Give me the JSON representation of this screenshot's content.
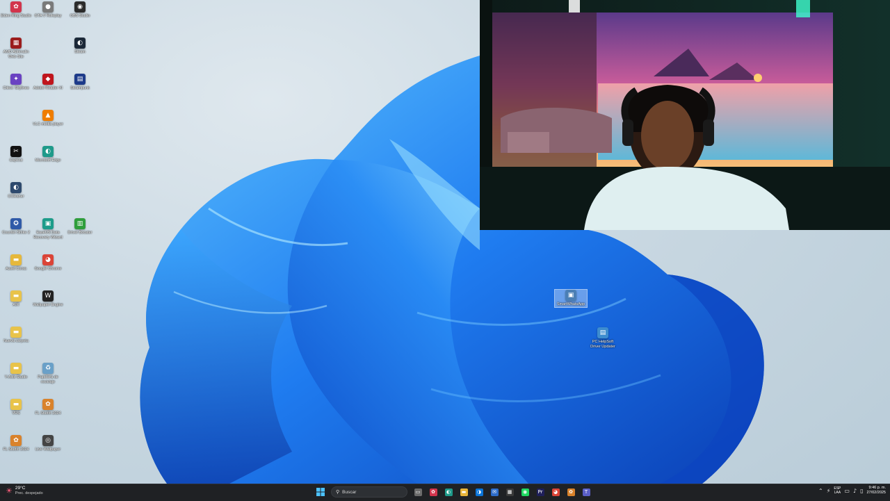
{
  "desktop_icons_left": [
    {
      "label": "Elden Ring Studio",
      "color": "#d2354d",
      "glyph": "✿"
    },
    {
      "label": "GTA V Roleplay",
      "color": "#7a7a7a",
      "glyph": "●"
    },
    {
      "label": "OBS Studio",
      "color": "#2b2b2b",
      "glyph": "◉"
    },
    {
      "label": "AMD Adrenalin Web Site",
      "color": "#9b1c1c",
      "glyph": "▦"
    },
    {
      "label": "Steam",
      "color": "#1b2838",
      "glyph": "◐"
    },
    {
      "label": "Cities: Skylines",
      "color": "#6a42c2",
      "glyph": "✦"
    },
    {
      "label": "Adobe Reader XI",
      "color": "#c0151d",
      "glyph": "◆"
    },
    {
      "label": "Steampunk",
      "color": "#1d3b8a",
      "glyph": "▤"
    },
    {
      "label": "VLC media player",
      "color": "#ef7d00",
      "glyph": "▲"
    },
    {
      "label": "CapCut",
      "color": "#111111",
      "glyph": "✂"
    },
    {
      "label": "Microsoft Edge",
      "color": "#1e9a8a",
      "glyph": "◐"
    },
    {
      "label": "CCleaner",
      "color": "#2e4a6e",
      "glyph": "◐"
    },
    {
      "label": "Counter-Strike 2",
      "color": "#2f5aa8",
      "glyph": "✪"
    },
    {
      "label": "EaseUS Data Recovery Wizard",
      "color": "#1c9c8a",
      "glyph": "▣"
    },
    {
      "label": "Driver Booster",
      "color": "#2f9e3c",
      "glyph": "▥"
    },
    {
      "label": "Asset Corsa",
      "color": "#e6b83c",
      "glyph": "▬"
    },
    {
      "label": "Google Chrome",
      "color": "#db4437",
      "glyph": "◕"
    },
    {
      "label": "AIR",
      "color": "#e8c34a",
      "glyph": "▬"
    },
    {
      "label": "Wallpaper Engine",
      "color": "#222222",
      "glyph": "W"
    },
    {
      "label": "Nueva carpeta",
      "color": "#e8c34a",
      "glyph": "▬"
    },
    {
      "label": "Y-Axis Studio",
      "color": "#e8c34a",
      "glyph": "▬"
    },
    {
      "label": "Papelera de reciclaje",
      "color": "#6aa0c8",
      "glyph": "♻"
    },
    {
      "label": "VRS",
      "color": "#e8c34a",
      "glyph": "▬"
    },
    {
      "label": "FL Studio 2024",
      "color": "#d9822b",
      "glyph": "✿"
    },
    {
      "label": "FL Studio 2024",
      "color": "#d9822b",
      "glyph": "✿"
    },
    {
      "label": "Live Wallpaper",
      "color": "#444444",
      "glyph": "◎"
    }
  ],
  "desktop_icons_right": [
    {
      "label": "SmartWhatsApp",
      "color": "#4a7fb5",
      "glyph": "▣",
      "selected": true
    },
    {
      "label": "PC HelpSoft Driver Updater",
      "color": "#3d8ccf",
      "glyph": "▤",
      "selected": false
    }
  ],
  "webcam": {
    "label": "Webcam overlay"
  },
  "taskbar": {
    "weather_temp": "29°C",
    "weather_desc": "Prec. despejado",
    "search_placeholder": "Buscar",
    "pinned": [
      {
        "name": "task-view",
        "color": "#6b6b6b",
        "glyph": "▭"
      },
      {
        "name": "copilot",
        "color": "#d2354d",
        "glyph": "✿"
      },
      {
        "name": "edge",
        "color": "#1e9a8a",
        "glyph": "◐"
      },
      {
        "name": "file-explorer",
        "color": "#e8b43a",
        "glyph": "▬"
      },
      {
        "name": "microsoft-edge-blue",
        "color": "#0a74d8",
        "glyph": "◑"
      },
      {
        "name": "mail",
        "color": "#2d6cc9",
        "glyph": "✉"
      },
      {
        "name": "store",
        "color": "#3a3a3a",
        "glyph": "▦"
      },
      {
        "name": "spotify",
        "color": "#1ed760",
        "glyph": "◉"
      },
      {
        "name": "premiere-pro",
        "color": "#1f1f5a",
        "glyph": "Pr"
      },
      {
        "name": "google-chrome",
        "color": "#db4437",
        "glyph": "◕"
      },
      {
        "name": "fl-studio",
        "color": "#d9822b",
        "glyph": "✿"
      },
      {
        "name": "teams",
        "color": "#5b5fc7",
        "glyph": "T"
      }
    ],
    "lang_top": "ESP",
    "lang_bottom": "LAA",
    "time": "9:46 p. m.",
    "date": "27/02/2025"
  }
}
